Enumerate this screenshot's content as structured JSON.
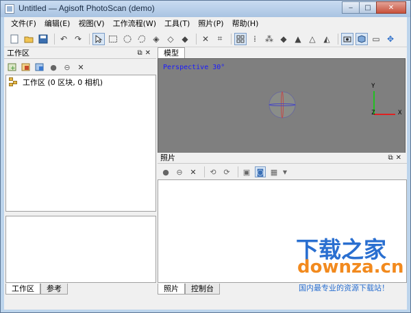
{
  "window": {
    "title": "Untitled — Agisoft PhotoScan (demo)",
    "minimize": "‒",
    "maximize": "□",
    "close": "✕"
  },
  "menu": [
    "文件(F)",
    "编辑(E)",
    "视图(V)",
    "工作流程(W)",
    "工具(T)",
    "照片(P)",
    "帮助(H)"
  ],
  "workspace": {
    "title": "工作区",
    "root_item": "工作区 (0 区块, 0 相机)",
    "tabs": [
      "工作区",
      "参考"
    ]
  },
  "model": {
    "tab": "模型",
    "perspective": "Perspective 30°",
    "axes": {
      "x": "X",
      "y": "Y",
      "z": "Z"
    }
  },
  "photos": {
    "title": "照片",
    "tabs": [
      "照片",
      "控制台"
    ]
  },
  "watermark": {
    "brand": "下载之家",
    "domain": "downza.cn",
    "slogan": "国内最专业的资源下载站！"
  },
  "colors": {
    "viewport_bg": "#7f7f7f",
    "perspective_text": "#1a1aff",
    "axis_x": "#e02020",
    "axis_y": "#20c020",
    "watermark_blue": "#2a6fd0",
    "watermark_orange": "#f28a1e"
  }
}
